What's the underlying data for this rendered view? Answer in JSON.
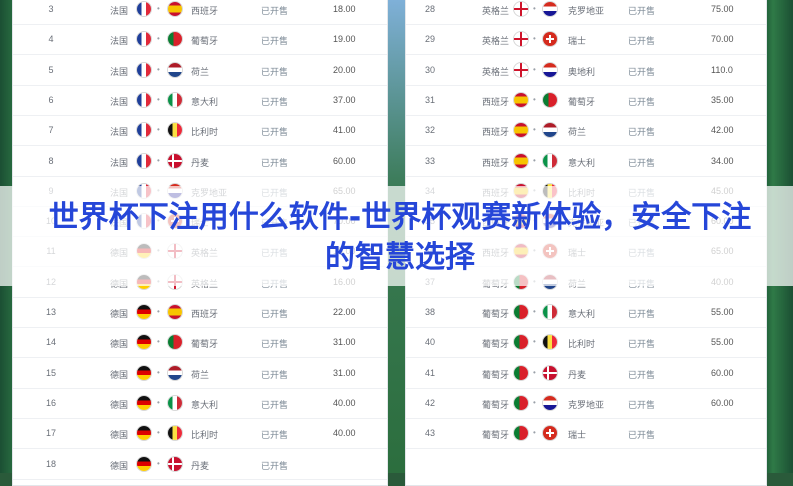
{
  "status_label": "已开售",
  "left_rows": [
    {
      "n": "3",
      "home": "法国",
      "hf": "fr",
      "away": "西班牙",
      "af": "es",
      "odds": "18.00"
    },
    {
      "n": "4",
      "home": "法国",
      "hf": "fr",
      "away": "葡萄牙",
      "af": "pt",
      "odds": "19.00"
    },
    {
      "n": "5",
      "home": "法国",
      "hf": "fr",
      "away": "荷兰",
      "af": "nl",
      "odds": "20.00"
    },
    {
      "n": "6",
      "home": "法国",
      "hf": "fr",
      "away": "意大利",
      "af": "it",
      "odds": "37.00"
    },
    {
      "n": "7",
      "home": "法国",
      "hf": "fr",
      "away": "比利时",
      "af": "be",
      "odds": "41.00"
    },
    {
      "n": "8",
      "home": "法国",
      "hf": "fr",
      "away": "丹麦",
      "af": "dk",
      "odds": "60.00"
    },
    {
      "n": "9",
      "home": "法国",
      "hf": "fr",
      "away": "克罗地亚",
      "af": "hr",
      "odds": "65.00"
    },
    {
      "n": "10",
      "home": "法国",
      "hf": "fr",
      "away": "瑞士",
      "af": "ch",
      "odds": "70.00"
    },
    {
      "n": "11",
      "home": "德国",
      "hf": "de",
      "away": "英格兰",
      "af": "en",
      "odds": "15.00"
    },
    {
      "n": "12",
      "home": "德国",
      "hf": "de",
      "away": "英格兰",
      "af": "en",
      "odds": "16.00"
    },
    {
      "n": "13",
      "home": "德国",
      "hf": "de",
      "away": "西班牙",
      "af": "es",
      "odds": "22.00"
    },
    {
      "n": "14",
      "home": "德国",
      "hf": "de",
      "away": "葡萄牙",
      "af": "pt",
      "odds": "31.00"
    },
    {
      "n": "15",
      "home": "德国",
      "hf": "de",
      "away": "荷兰",
      "af": "nl",
      "odds": "31.00"
    },
    {
      "n": "16",
      "home": "德国",
      "hf": "de",
      "away": "意大利",
      "af": "it",
      "odds": "40.00"
    },
    {
      "n": "17",
      "home": "德国",
      "hf": "de",
      "away": "比利时",
      "af": "be",
      "odds": "40.00"
    },
    {
      "n": "18",
      "home": "德国",
      "hf": "de",
      "away": "丹麦",
      "af": "dk",
      "odds": ""
    }
  ],
  "right_rows": [
    {
      "n": "28",
      "home": "英格兰",
      "hf": "en",
      "away": "克罗地亚",
      "af": "hr",
      "odds": "75.00"
    },
    {
      "n": "29",
      "home": "英格兰",
      "hf": "en",
      "away": "瑞士",
      "af": "ch",
      "odds": "70.00"
    },
    {
      "n": "30",
      "home": "英格兰",
      "hf": "en",
      "away": "奥地利",
      "af": "hr",
      "odds": "110.0"
    },
    {
      "n": "31",
      "home": "西班牙",
      "hf": "es",
      "away": "葡萄牙",
      "af": "pt",
      "odds": "35.00"
    },
    {
      "n": "32",
      "home": "西班牙",
      "hf": "es",
      "away": "荷兰",
      "af": "nl",
      "odds": "42.00"
    },
    {
      "n": "33",
      "home": "西班牙",
      "hf": "es",
      "away": "意大利",
      "af": "it",
      "odds": "34.00"
    },
    {
      "n": "34",
      "home": "西班牙",
      "hf": "es",
      "away": "比利时",
      "af": "be",
      "odds": "45.00"
    },
    {
      "n": "35",
      "home": "西班牙",
      "hf": "es",
      "away": "克罗地亚",
      "af": "hr",
      "odds": "60.00"
    },
    {
      "n": "36",
      "home": "西班牙",
      "hf": "es",
      "away": "瑞士",
      "af": "ch",
      "odds": "65.00"
    },
    {
      "n": "37",
      "home": "葡萄牙",
      "hf": "pt",
      "away": "荷兰",
      "af": "nl",
      "odds": "40.00"
    },
    {
      "n": "38",
      "home": "葡萄牙",
      "hf": "pt",
      "away": "意大利",
      "af": "it",
      "odds": "55.00"
    },
    {
      "n": "40",
      "home": "葡萄牙",
      "hf": "pt",
      "away": "比利时",
      "af": "be",
      "odds": "55.00"
    },
    {
      "n": "41",
      "home": "葡萄牙",
      "hf": "pt",
      "away": "丹麦",
      "af": "dk",
      "odds": "60.00"
    },
    {
      "n": "42",
      "home": "葡萄牙",
      "hf": "pt",
      "away": "克罗地亚",
      "af": "hr",
      "odds": "60.00"
    },
    {
      "n": "43",
      "home": "葡萄牙",
      "hf": "pt",
      "away": "瑞士",
      "af": "ch",
      "odds": ""
    }
  ],
  "banner": {
    "title": "世界杯下注用什么软件-世界杯观赛新体验，安全下注的智慧选择"
  }
}
